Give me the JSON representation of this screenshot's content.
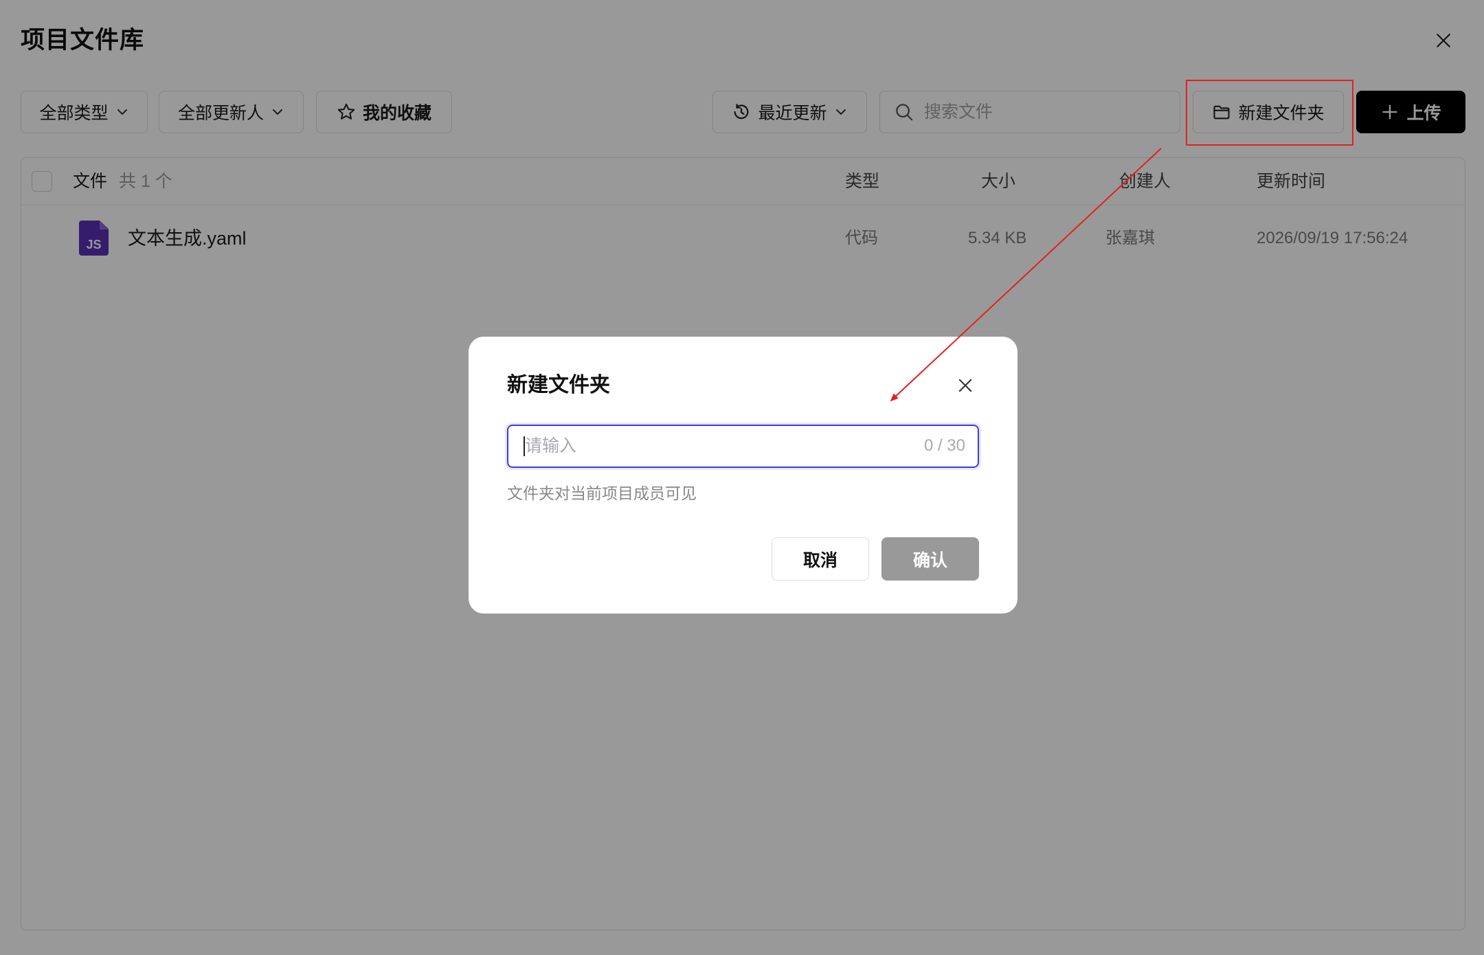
{
  "page": {
    "title": "项目文件库"
  },
  "toolbar": {
    "type_filter": "全部类型",
    "updater_filter": "全部更新人",
    "favorites": "我的收藏",
    "sort": "最近更新",
    "search_placeholder": "搜索文件",
    "new_folder": "新建文件夹",
    "upload": "上传"
  },
  "table": {
    "columns": {
      "file": "文件",
      "count": "共 1 个",
      "type": "类型",
      "size": "大小",
      "creator": "创建人",
      "updated": "更新时间"
    },
    "rows": [
      {
        "icon": "js-file-icon",
        "icon_text": "JS",
        "name": "文本生成.yaml",
        "type": "代码",
        "size": "5.34 KB",
        "creator": "张嘉琪",
        "updated": "2026/09/19 17:56:24"
      }
    ]
  },
  "modal": {
    "title": "新建文件夹",
    "input_value": "",
    "input_placeholder": "请输入",
    "counter": "0 / 30",
    "hint": "文件夹对当前项目成员可见",
    "cancel": "取消",
    "confirm": "确认"
  },
  "icons": {
    "page_close": "close-icon",
    "type_filter": "chevron-down-icon",
    "updater_filter": "chevron-down-icon",
    "favorites": "star-icon",
    "sort": "clock-refresh-icon",
    "search": "search-icon",
    "new_folder": "folder-icon",
    "upload": "plus-icon",
    "modal_close": "close-icon"
  },
  "colors": {
    "overlay": "rgba(0,0,0,0.4)",
    "primary": "#000000",
    "focus": "#3d3ddb",
    "disabled": "#999999",
    "annot": "#e3211f",
    "jsicon": "#5b30b6"
  }
}
